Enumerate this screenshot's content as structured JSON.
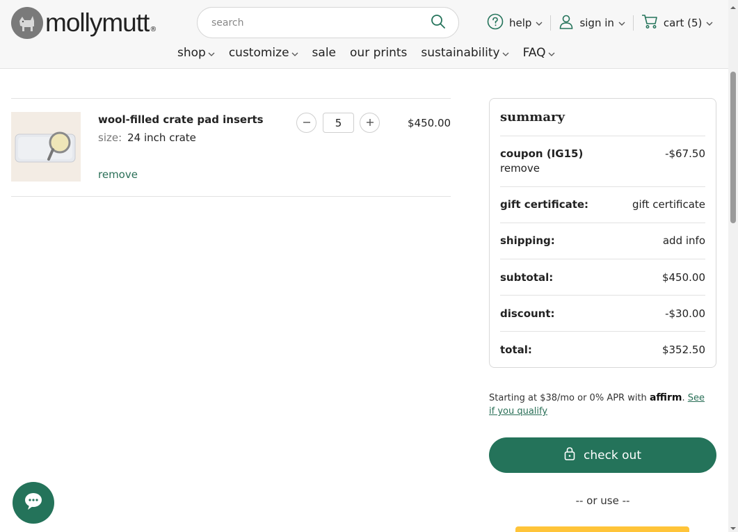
{
  "header": {
    "logo_text": "mollymutt",
    "logo_reg": "®",
    "search_placeholder": "search",
    "help_label": "help",
    "signin_label": "sign in",
    "cart_label": "cart (5)"
  },
  "nav": {
    "items": [
      {
        "label": "shop",
        "dropdown": true
      },
      {
        "label": "customize",
        "dropdown": true
      },
      {
        "label": "sale",
        "dropdown": false
      },
      {
        "label": "our prints",
        "dropdown": false
      },
      {
        "label": "sustainability",
        "dropdown": true
      },
      {
        "label": "FAQ",
        "dropdown": true
      }
    ]
  },
  "cart_item": {
    "title": "wool-filled crate pad inserts",
    "size_key": "size:",
    "size_value": "24 inch crate",
    "remove_label": "remove",
    "quantity": "5",
    "price": "$450.00"
  },
  "summary": {
    "title": "summary",
    "coupon_key": "coupon (IG15)",
    "coupon_value": "-$67.50",
    "coupon_remove": "remove",
    "gift_key": "gift certificate:",
    "gift_value": "gift certificate",
    "shipping_key": "shipping:",
    "shipping_value": "add info",
    "subtotal_key": "subtotal:",
    "subtotal_value": "$450.00",
    "discount_key": "discount:",
    "discount_value": "-$30.00",
    "total_key": "total:",
    "total_value": "$352.50"
  },
  "affirm": {
    "text": "Starting at $38/mo or 0% APR with",
    "brand": "affirm",
    "link": "See if you qualify"
  },
  "checkout": {
    "label": "check out",
    "or_use": "-- or use --"
  },
  "colors": {
    "accent": "#24735a",
    "link": "#2a6f57",
    "paypal": "#ffc439"
  }
}
